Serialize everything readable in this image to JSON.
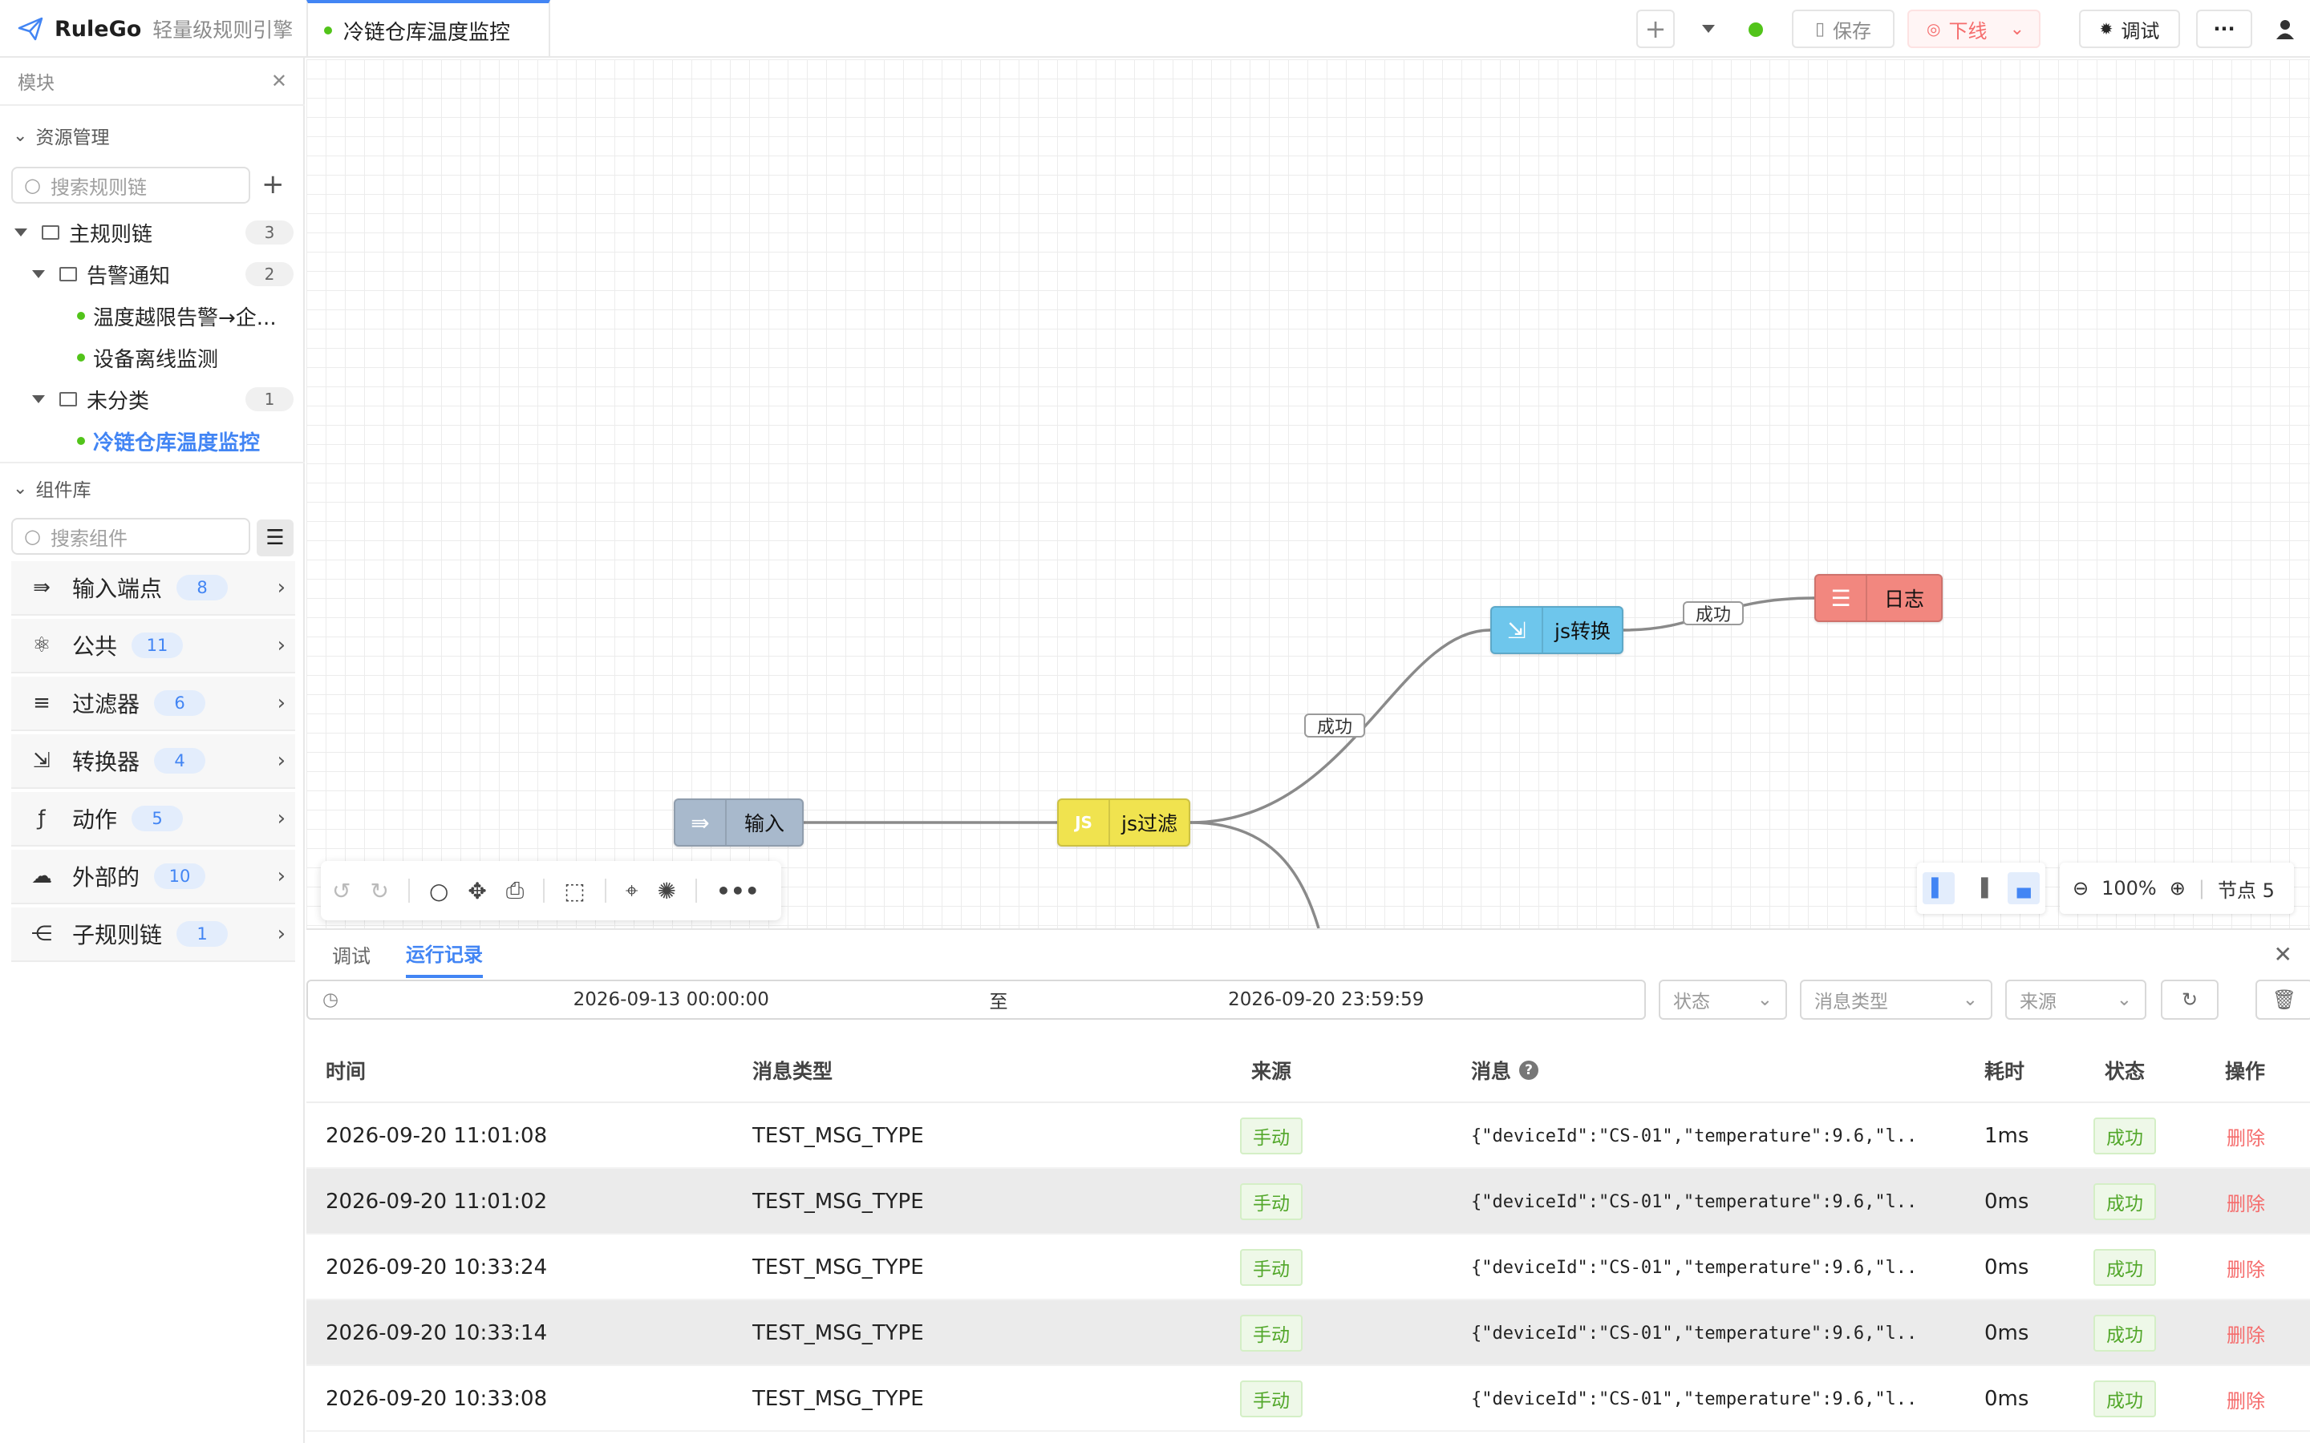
{
  "app": {
    "name": "RuleGo",
    "subtitle": "轻量级规则引擎"
  },
  "tab": {
    "title": "冷链仓库温度监控"
  },
  "toolbar": {
    "add": "+",
    "save": "保存",
    "offline": "下线",
    "debug": "调试",
    "more": "···"
  },
  "sidebar": {
    "panel_title": "模块",
    "resources_title": "资源管理",
    "search_chain_placeholder": "搜索规则链",
    "tree": {
      "main": {
        "label": "主规则链",
        "count": "3"
      },
      "alerts": {
        "label": "告警通知",
        "count": "2"
      },
      "alert_items": [
        "温度越限告警→企...",
        "设备离线监测"
      ],
      "uncategorized": {
        "label": "未分类",
        "count": "1"
      },
      "uncat_items": [
        "冷链仓库温度监控"
      ]
    },
    "components_title": "组件库",
    "search_component_placeholder": "搜索组件",
    "components": [
      {
        "icon": "⇛",
        "label": "输入端点",
        "count": "8"
      },
      {
        "icon": "⚛",
        "label": "公共",
        "count": "11"
      },
      {
        "icon": "≡",
        "label": "过滤器",
        "count": "6"
      },
      {
        "icon": "⇲",
        "label": "转换器",
        "count": "4"
      },
      {
        "icon": "ƒ",
        "label": "动作",
        "count": "5"
      },
      {
        "icon": "☁",
        "label": "外部的",
        "count": "10"
      },
      {
        "icon": "⋲",
        "label": "子规则链",
        "count": "1"
      }
    ]
  },
  "canvas": {
    "nodes": {
      "input": "输入",
      "js_filter": "js过滤",
      "js_transform": "js转换",
      "log": "日志"
    },
    "edge_labels": {
      "filter_to_transform": "成功",
      "transform_to_log": "成功"
    },
    "zoom": "100%",
    "node_count": "节点 5",
    "colors": {
      "input": "#a8b9cc",
      "filter": "#f0e34f",
      "transform": "#6ec6ec",
      "log": "#f2877f"
    }
  },
  "bottom": {
    "tabs": [
      "调试",
      "运行记录"
    ],
    "active_tab": "运行记录",
    "range_start": "2026-09-13 00:00:00",
    "range_sep": "至",
    "range_end": "2026-09-20 23:59:59",
    "status_placeholder": "状态",
    "msgtype_placeholder": "消息类型",
    "source_placeholder": "来源",
    "columns": [
      "时间",
      "消息类型",
      "来源",
      "消息",
      "耗时",
      "状态",
      "操作"
    ],
    "rows": [
      {
        "time": "2026-09-20 11:01:08",
        "type": "TEST_MSG_TYPE",
        "source": "手动",
        "msg": "{\"deviceId\":\"CS-01\",\"temperature\":9.6,\"l...",
        "cost": "1ms",
        "status": "成功",
        "action": "删除"
      },
      {
        "time": "2026-09-20 11:01:02",
        "type": "TEST_MSG_TYPE",
        "source": "手动",
        "msg": "{\"deviceId\":\"CS-01\",\"temperature\":9.6,\"l...",
        "cost": "0ms",
        "status": "成功",
        "action": "删除"
      },
      {
        "time": "2026-09-20 10:33:24",
        "type": "TEST_MSG_TYPE",
        "source": "手动",
        "msg": "{\"deviceId\":\"CS-01\",\"temperature\":9.6,\"l...",
        "cost": "0ms",
        "status": "成功",
        "action": "删除"
      },
      {
        "time": "2026-09-20 10:33:14",
        "type": "TEST_MSG_TYPE",
        "source": "手动",
        "msg": "{\"deviceId\":\"CS-01\",\"temperature\":9.6,\"l...",
        "cost": "0ms",
        "status": "成功",
        "action": "删除"
      },
      {
        "time": "2026-09-20 10:33:08",
        "type": "TEST_MSG_TYPE",
        "source": "手动",
        "msg": "{\"deviceId\":\"CS-01\",\"temperature\":9.6,\"l...",
        "cost": "0ms",
        "status": "成功",
        "action": "删除"
      }
    ]
  }
}
